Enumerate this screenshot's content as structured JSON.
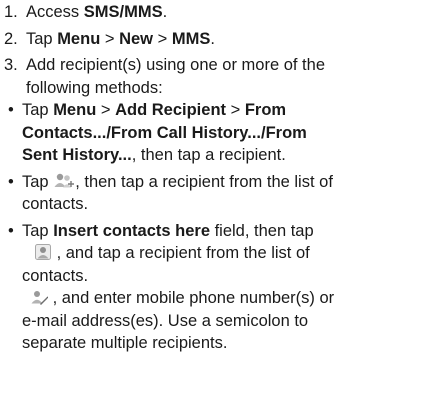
{
  "steps": [
    {
      "num": "1.",
      "t1": "Access ",
      "b1": "SMS/MMS",
      "t2": "."
    },
    {
      "num": "2.",
      "t1": "Tap ",
      "b1": "Menu",
      "t2": " > ",
      "b2": "New",
      "t3": " > ",
      "b3": "MMS",
      "t4": "."
    },
    {
      "num": "3.",
      "line1": "Add recipient(s) using one or more of the",
      "line2": "following methods:"
    }
  ],
  "bullets": {
    "glyph": "•",
    "b1": {
      "t1": "Tap ",
      "b1": "Menu",
      "t2": " > ",
      "b2": "Add Recipient",
      "t3": " > ",
      "b3": "From",
      "b4": "Contacts.../From Call History.../From",
      "b5": "Sent History...",
      "t4": ", then tap a recipient."
    },
    "b2": {
      "t1": "Tap ",
      "icon": "contacts-list-icon",
      "t2": ", then tap a recipient from the list of",
      "t3": "contacts."
    },
    "b3": {
      "t1": "Tap ",
      "b1": "Insert contacts here",
      "t2": " field, then tap",
      "icon1": "single-contact-icon",
      "t3": " , and tap a recipient from the list of",
      "t4": "contacts.",
      "icon2": "edit-contact-icon",
      "t5": " , and enter mobile phone number(s) or",
      "t6": "e-mail address(es). Use a semicolon to",
      "t7": "separate multiple recipients."
    }
  },
  "colors": {
    "text": "#1a1a1a",
    "icon_accent": "#8a8a8a"
  }
}
